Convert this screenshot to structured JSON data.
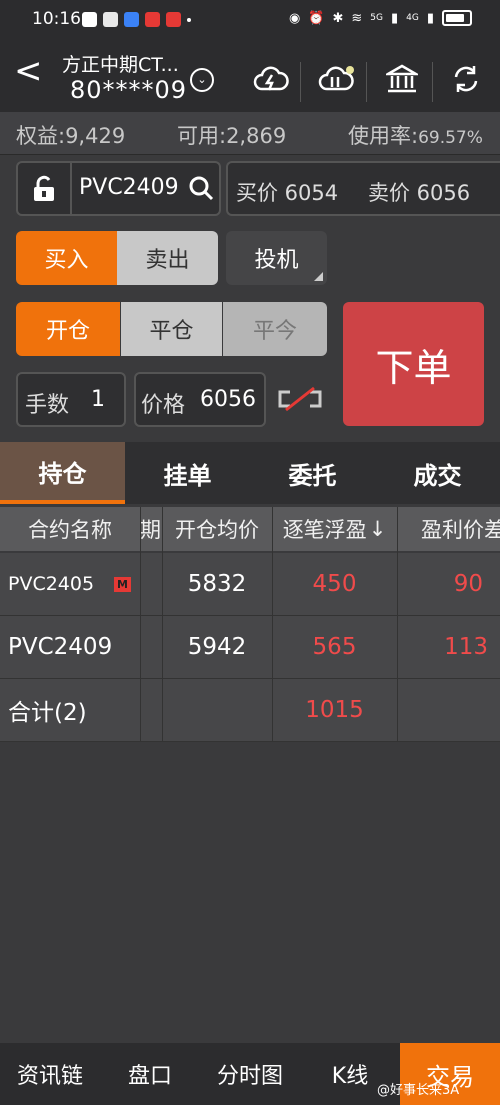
{
  "status": {
    "time": "10:16",
    "network": "5G",
    "network2": "4G"
  },
  "header": {
    "account_name": "方正中期CT...",
    "account_no": "80****09"
  },
  "summary": {
    "equity": "权益:9,429",
    "available": "可用:2,869",
    "usage_label": "使用率:",
    "usage_value": "69.57%"
  },
  "order": {
    "contract": "PVC2409",
    "bid": "买价 6054",
    "ask": "卖价 6056",
    "buy_label": "买入",
    "sell_label": "卖出",
    "spec_label": "投机",
    "open_label": "开仓",
    "close_label": "平仓",
    "close_today_label": "平今",
    "submit_label": "下单",
    "qty_label": "手数",
    "qty_value": "1",
    "price_label": "价格",
    "price_value": "6056"
  },
  "tabs": [
    "持仓",
    "挂单",
    "委托",
    "成交"
  ],
  "table": {
    "headers": [
      "合约名称",
      "期",
      "开仓均价",
      "逐笔浮盈",
      "盈利价差"
    ],
    "sort_arrow": "↓",
    "rows": [
      {
        "name": "PVC2405",
        "badge": "M",
        "avg": "5832",
        "pnl": "450",
        "spread": "90"
      },
      {
        "name": "PVC2409",
        "badge": "",
        "avg": "5942",
        "pnl": "565",
        "spread": "113"
      }
    ],
    "total": {
      "name": "合计(2)",
      "pnl": "1015"
    }
  },
  "bottomnav": [
    "资讯链",
    "盘口",
    "分时图",
    "K线",
    "交易"
  ],
  "watermark": "@好事长来3A",
  "colors": {
    "accent": "#f0720c",
    "profit": "#f04b4b",
    "submit": "#cd4346"
  }
}
